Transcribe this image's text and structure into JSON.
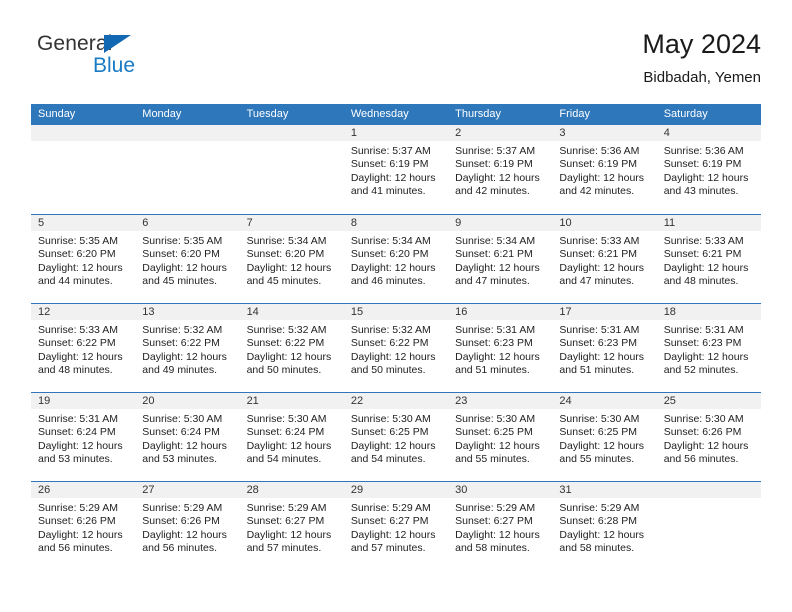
{
  "brand": {
    "line1": "General",
    "line2": "Blue",
    "accent_color": "#1a7bc4",
    "triangle_color": "#1268b3"
  },
  "header": {
    "title": "May 2024",
    "location": "Bidbadah, Yemen"
  },
  "calendar": {
    "header_color": "#2f77bb",
    "band_color": "#f1f1f1",
    "weekdays": [
      "Sunday",
      "Monday",
      "Tuesday",
      "Wednesday",
      "Thursday",
      "Friday",
      "Saturday"
    ],
    "weeks": [
      [
        {
          "day": "",
          "sunrise": "",
          "sunset": "",
          "daylight_line1": "",
          "daylight_line2": ""
        },
        {
          "day": "",
          "sunrise": "",
          "sunset": "",
          "daylight_line1": "",
          "daylight_line2": ""
        },
        {
          "day": "",
          "sunrise": "",
          "sunset": "",
          "daylight_line1": "",
          "daylight_line2": ""
        },
        {
          "day": "1",
          "sunrise": "Sunrise: 5:37 AM",
          "sunset": "Sunset: 6:19 PM",
          "daylight_line1": "Daylight: 12 hours",
          "daylight_line2": "and 41 minutes."
        },
        {
          "day": "2",
          "sunrise": "Sunrise: 5:37 AM",
          "sunset": "Sunset: 6:19 PM",
          "daylight_line1": "Daylight: 12 hours",
          "daylight_line2": "and 42 minutes."
        },
        {
          "day": "3",
          "sunrise": "Sunrise: 5:36 AM",
          "sunset": "Sunset: 6:19 PM",
          "daylight_line1": "Daylight: 12 hours",
          "daylight_line2": "and 42 minutes."
        },
        {
          "day": "4",
          "sunrise": "Sunrise: 5:36 AM",
          "sunset": "Sunset: 6:19 PM",
          "daylight_line1": "Daylight: 12 hours",
          "daylight_line2": "and 43 minutes."
        }
      ],
      [
        {
          "day": "5",
          "sunrise": "Sunrise: 5:35 AM",
          "sunset": "Sunset: 6:20 PM",
          "daylight_line1": "Daylight: 12 hours",
          "daylight_line2": "and 44 minutes."
        },
        {
          "day": "6",
          "sunrise": "Sunrise: 5:35 AM",
          "sunset": "Sunset: 6:20 PM",
          "daylight_line1": "Daylight: 12 hours",
          "daylight_line2": "and 45 minutes."
        },
        {
          "day": "7",
          "sunrise": "Sunrise: 5:34 AM",
          "sunset": "Sunset: 6:20 PM",
          "daylight_line1": "Daylight: 12 hours",
          "daylight_line2": "and 45 minutes."
        },
        {
          "day": "8",
          "sunrise": "Sunrise: 5:34 AM",
          "sunset": "Sunset: 6:20 PM",
          "daylight_line1": "Daylight: 12 hours",
          "daylight_line2": "and 46 minutes."
        },
        {
          "day": "9",
          "sunrise": "Sunrise: 5:34 AM",
          "sunset": "Sunset: 6:21 PM",
          "daylight_line1": "Daylight: 12 hours",
          "daylight_line2": "and 47 minutes."
        },
        {
          "day": "10",
          "sunrise": "Sunrise: 5:33 AM",
          "sunset": "Sunset: 6:21 PM",
          "daylight_line1": "Daylight: 12 hours",
          "daylight_line2": "and 47 minutes."
        },
        {
          "day": "11",
          "sunrise": "Sunrise: 5:33 AM",
          "sunset": "Sunset: 6:21 PM",
          "daylight_line1": "Daylight: 12 hours",
          "daylight_line2": "and 48 minutes."
        }
      ],
      [
        {
          "day": "12",
          "sunrise": "Sunrise: 5:33 AM",
          "sunset": "Sunset: 6:22 PM",
          "daylight_line1": "Daylight: 12 hours",
          "daylight_line2": "and 48 minutes."
        },
        {
          "day": "13",
          "sunrise": "Sunrise: 5:32 AM",
          "sunset": "Sunset: 6:22 PM",
          "daylight_line1": "Daylight: 12 hours",
          "daylight_line2": "and 49 minutes."
        },
        {
          "day": "14",
          "sunrise": "Sunrise: 5:32 AM",
          "sunset": "Sunset: 6:22 PM",
          "daylight_line1": "Daylight: 12 hours",
          "daylight_line2": "and 50 minutes."
        },
        {
          "day": "15",
          "sunrise": "Sunrise: 5:32 AM",
          "sunset": "Sunset: 6:22 PM",
          "daylight_line1": "Daylight: 12 hours",
          "daylight_line2": "and 50 minutes."
        },
        {
          "day": "16",
          "sunrise": "Sunrise: 5:31 AM",
          "sunset": "Sunset: 6:23 PM",
          "daylight_line1": "Daylight: 12 hours",
          "daylight_line2": "and 51 minutes."
        },
        {
          "day": "17",
          "sunrise": "Sunrise: 5:31 AM",
          "sunset": "Sunset: 6:23 PM",
          "daylight_line1": "Daylight: 12 hours",
          "daylight_line2": "and 51 minutes."
        },
        {
          "day": "18",
          "sunrise": "Sunrise: 5:31 AM",
          "sunset": "Sunset: 6:23 PM",
          "daylight_line1": "Daylight: 12 hours",
          "daylight_line2": "and 52 minutes."
        }
      ],
      [
        {
          "day": "19",
          "sunrise": "Sunrise: 5:31 AM",
          "sunset": "Sunset: 6:24 PM",
          "daylight_line1": "Daylight: 12 hours",
          "daylight_line2": "and 53 minutes."
        },
        {
          "day": "20",
          "sunrise": "Sunrise: 5:30 AM",
          "sunset": "Sunset: 6:24 PM",
          "daylight_line1": "Daylight: 12 hours",
          "daylight_line2": "and 53 minutes."
        },
        {
          "day": "21",
          "sunrise": "Sunrise: 5:30 AM",
          "sunset": "Sunset: 6:24 PM",
          "daylight_line1": "Daylight: 12 hours",
          "daylight_line2": "and 54 minutes."
        },
        {
          "day": "22",
          "sunrise": "Sunrise: 5:30 AM",
          "sunset": "Sunset: 6:25 PM",
          "daylight_line1": "Daylight: 12 hours",
          "daylight_line2": "and 54 minutes."
        },
        {
          "day": "23",
          "sunrise": "Sunrise: 5:30 AM",
          "sunset": "Sunset: 6:25 PM",
          "daylight_line1": "Daylight: 12 hours",
          "daylight_line2": "and 55 minutes."
        },
        {
          "day": "24",
          "sunrise": "Sunrise: 5:30 AM",
          "sunset": "Sunset: 6:25 PM",
          "daylight_line1": "Daylight: 12 hours",
          "daylight_line2": "and 55 minutes."
        },
        {
          "day": "25",
          "sunrise": "Sunrise: 5:30 AM",
          "sunset": "Sunset: 6:26 PM",
          "daylight_line1": "Daylight: 12 hours",
          "daylight_line2": "and 56 minutes."
        }
      ],
      [
        {
          "day": "26",
          "sunrise": "Sunrise: 5:29 AM",
          "sunset": "Sunset: 6:26 PM",
          "daylight_line1": "Daylight: 12 hours",
          "daylight_line2": "and 56 minutes."
        },
        {
          "day": "27",
          "sunrise": "Sunrise: 5:29 AM",
          "sunset": "Sunset: 6:26 PM",
          "daylight_line1": "Daylight: 12 hours",
          "daylight_line2": "and 56 minutes."
        },
        {
          "day": "28",
          "sunrise": "Sunrise: 5:29 AM",
          "sunset": "Sunset: 6:27 PM",
          "daylight_line1": "Daylight: 12 hours",
          "daylight_line2": "and 57 minutes."
        },
        {
          "day": "29",
          "sunrise": "Sunrise: 5:29 AM",
          "sunset": "Sunset: 6:27 PM",
          "daylight_line1": "Daylight: 12 hours",
          "daylight_line2": "and 57 minutes."
        },
        {
          "day": "30",
          "sunrise": "Sunrise: 5:29 AM",
          "sunset": "Sunset: 6:27 PM",
          "daylight_line1": "Daylight: 12 hours",
          "daylight_line2": "and 58 minutes."
        },
        {
          "day": "31",
          "sunrise": "Sunrise: 5:29 AM",
          "sunset": "Sunset: 6:28 PM",
          "daylight_line1": "Daylight: 12 hours",
          "daylight_line2": "and 58 minutes."
        },
        {
          "day": "",
          "sunrise": "",
          "sunset": "",
          "daylight_line1": "",
          "daylight_line2": ""
        }
      ]
    ]
  }
}
